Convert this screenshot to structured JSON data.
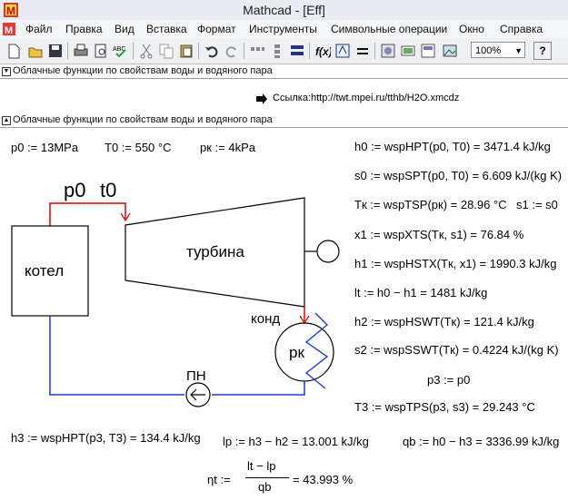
{
  "window": {
    "title": "Mathcad - [Eff]"
  },
  "menu": [
    "Файл",
    "Правка",
    "Вид",
    "Вставка",
    "Формат",
    "Инструменты",
    "Символьные операции",
    "Окно",
    "Справка"
  ],
  "toolbar": {
    "zoom": "100%",
    "help": "?"
  },
  "sections": {
    "collapsed_title": "Облачные функции по свойствам воды и водяного пара",
    "link_text": "Ссылка:http://twt.mpei.ru/tthb/H2O.xmcdz",
    "expanded_title": "Облачные функции по свойствам воды и водяного пара"
  },
  "inputs": {
    "p0": "p0 := 13MPa",
    "t0": "T0 := 550 °C",
    "pk": "pк := 4kPa"
  },
  "diagram": {
    "p0": "p0",
    "t0": "t0",
    "boiler": "котел",
    "turbine": "турбина",
    "condenser": "конд",
    "pk": "pк",
    "pump": "ПН"
  },
  "formulas": {
    "h0": "h0 := wspHPT(p0, T0) = 3471.4 kJ/kg",
    "s0": "s0 := wspSPT(p0, T0) = 6.609 kJ/(kg K)",
    "Tk": "Tк := wspTSP(pк) = 28.96 °C",
    "s1": "s1 := s0",
    "x1": "x1 := wspXTS(Tк, s1) = 76.84 %",
    "h1": "h1 := wspHSTX(Tк, x1) = 1990.3 kJ/kg",
    "lt": "lt := h0 − h1 = 1481 kJ/kg",
    "h2": "h2 := wspHSWT(Tк) = 121.4 kJ/kg",
    "s2": "s2 := wspSSWT(Tк) = 0.4224 kJ/(kg K)",
    "p3": "p3 := p0",
    "T3": "T3 := wspTPS(p3, s3) = 29.243 °C",
    "h3": "h3 := wspHPT(p3, T3) = 134.4 kJ/kg",
    "lp": "lp := h3 − h2 = 13.001 kJ/kg",
    "qb": "qb := h0 − h3 = 3336.99 kJ/kg",
    "eta_lhs": "ηt :=",
    "eta_num": "lt − lp",
    "eta_den": "qb",
    "eta_val": "= 43.993 %"
  },
  "colors": {
    "red_line": "#e00000",
    "blue_line": "#1a3fd8",
    "cross_blue": "#1a3fd8"
  }
}
